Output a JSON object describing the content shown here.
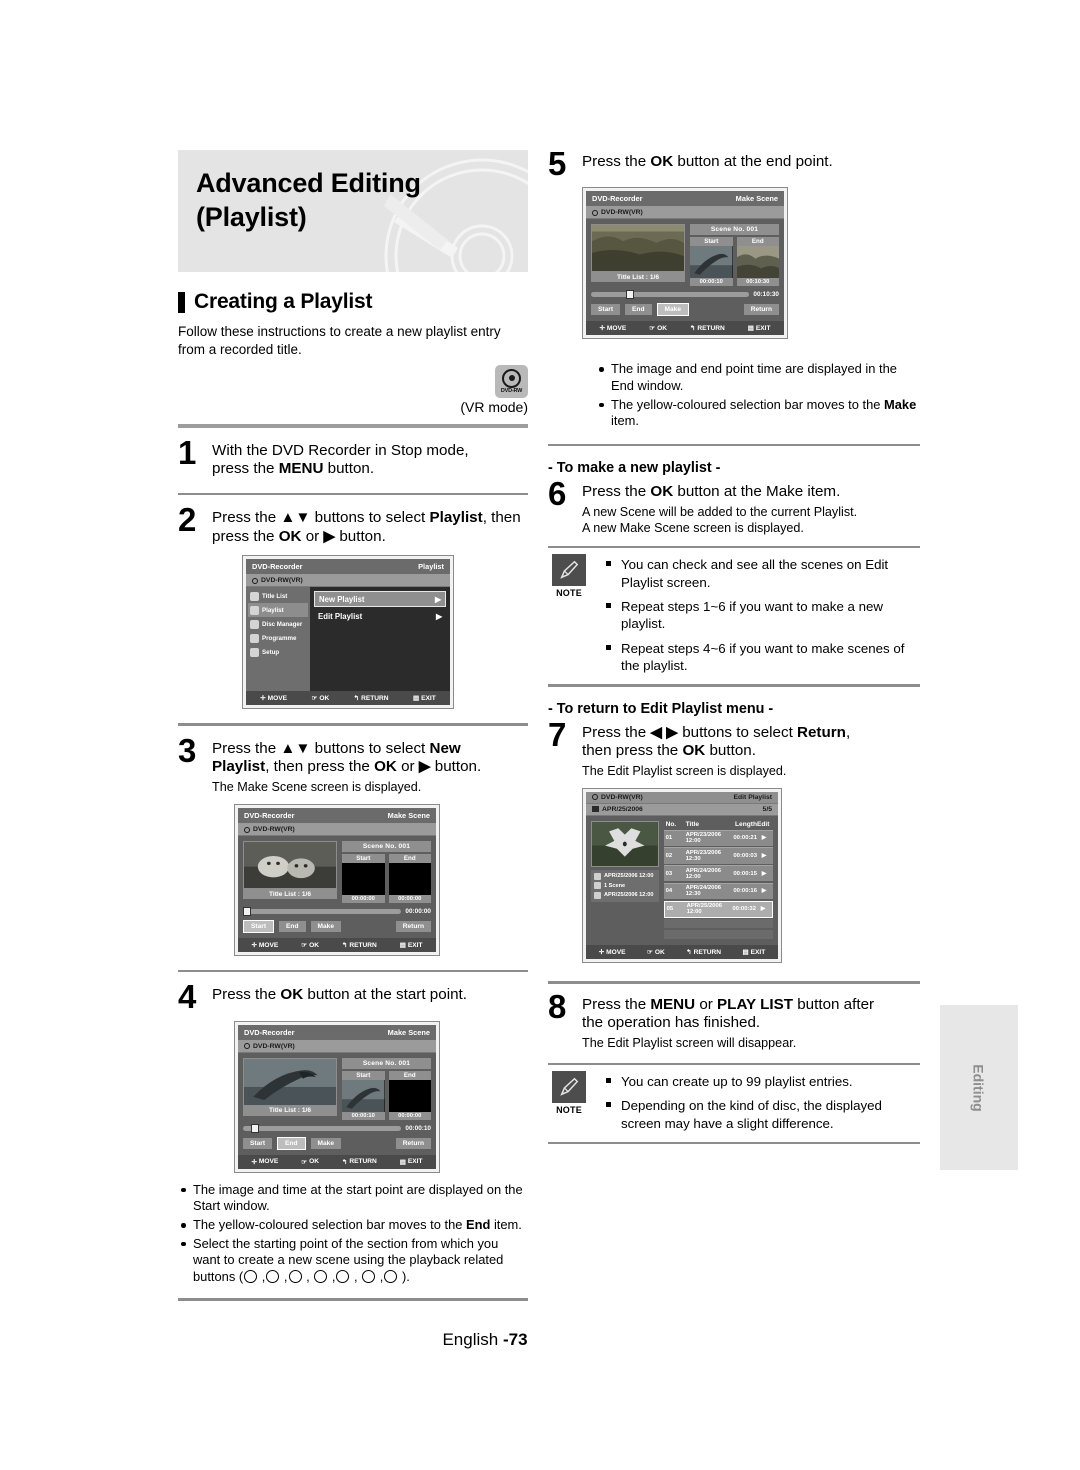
{
  "banner": {
    "title_line1": "Advanced Editing",
    "title_line2": "(Playlist)"
  },
  "section": {
    "heading": "Creating a Playlist",
    "intro": "Follow these instructions to create a new playlist entry from a recorded title.",
    "disc_badge": "DVD-RW",
    "mode": "(VR mode)"
  },
  "steps": {
    "s1": {
      "num": "1",
      "line1": "With the DVD Recorder in Stop mode,",
      "line2": "press the MENU button."
    },
    "s2": {
      "num": "2",
      "line1": "Press the ▲▼ buttons to select Playlist, then",
      "line2": "press the OK or ▶ button."
    },
    "s3": {
      "num": "3",
      "line1": "Press the ▲▼ buttons to select New",
      "line2": "Playlist, then press the OK or ▶ button.",
      "sub": "The Make Scene screen is displayed."
    },
    "s4": {
      "num": "4",
      "line1": "Press the OK button at the start point."
    },
    "s5": {
      "num": "5",
      "line1": "Press the OK button at the end point."
    },
    "s6": {
      "num": "6",
      "line1": "Press the OK button at the Make item.",
      "sub1": "A new Scene will be added to the current Playlist.",
      "sub2": "A new Make Scene screen is displayed."
    },
    "s7": {
      "num": "7",
      "line1": "Press the ◀ ▶ buttons to select Return,",
      "line2": "then press the OK button.",
      "sub": "The Edit Playlist screen is displayed."
    },
    "s8": {
      "num": "8",
      "line1": "Press the MENU or PLAY LIST button after",
      "line2": "the operation has finished.",
      "sub": "The Edit Playlist screen will disappear."
    }
  },
  "bullets_step4": [
    "The image and time at the start point are displayed on the Start window.",
    "The yellow-coloured selection bar moves to the End item.",
    "Select the starting point of the section from which you want to create a new scene using the playback related buttons"
  ],
  "bullets_step5": [
    "The image and end point time are displayed in the End window.",
    "The yellow-coloured selection bar moves to the Make item."
  ],
  "subheads": {
    "make_new": "- To make a new playlist -",
    "return_edit": "- To return to Edit Playlist menu -"
  },
  "note1": {
    "caption": "NOTE",
    "items": [
      "You can check and see all the scenes on Edit Playlist screen.",
      "Repeat steps 1~6 if you want to make a new playlist.",
      "Repeat steps 4~6 if you want to make scenes of the playlist."
    ]
  },
  "note2": {
    "caption": "NOTE",
    "items": [
      "You can create up to 99 playlist entries.",
      "Depending on the kind of disc, the displayed screen may have a slight difference."
    ]
  },
  "osd_common": {
    "recorder": "DVD-Recorder",
    "disc": "DVD-RW(VR)",
    "foot_move": "MOVE",
    "foot_ok": "OK",
    "foot_return": "RETURN",
    "foot_exit": "EXIT"
  },
  "osd_menu": {
    "title_right": "Playlist",
    "side_items": [
      {
        "label": "Title List",
        "selected": false
      },
      {
        "label": "Playlist",
        "selected": true
      },
      {
        "label": "Disc Manager",
        "selected": false
      },
      {
        "label": "Programme",
        "selected": false
      },
      {
        "label": "Setup",
        "selected": false
      }
    ],
    "rows": [
      {
        "label": "New Playlist",
        "selected": true,
        "arrow": "▶"
      },
      {
        "label": "Edit Playlist",
        "selected": false,
        "arrow": "▶"
      }
    ]
  },
  "osd_make_scene_3": {
    "title_right": "Make Scene",
    "caption": "Title List : 1/6",
    "scene_label": "Scene  No. 001",
    "start_label": "Start",
    "end_label": "End",
    "start_time": "00:00:00",
    "end_time": "00:00:00",
    "total_time": "00:00:00",
    "knob_pct": 0,
    "btn_start": "Start",
    "btn_end": "End",
    "btn_make": "Make",
    "btn_return": "Return",
    "selected_btn": "Start"
  },
  "osd_make_scene_4": {
    "title_right": "Make Scene",
    "caption": "Title List : 1/6",
    "scene_label": "Scene  No. 001",
    "start_label": "Start",
    "end_label": "End",
    "start_time": "00:00:10",
    "end_time": "00:00:00",
    "total_time": "00:00:10",
    "knob_pct": 5,
    "btn_start": "Start",
    "btn_end": "End",
    "btn_make": "Make",
    "btn_return": "Return",
    "selected_btn": "End"
  },
  "osd_make_scene_5": {
    "title_right": "Make Scene",
    "caption": "Title List : 1/6",
    "scene_label": "Scene  No. 001",
    "start_label": "Start",
    "end_label": "End",
    "start_time": "00:00:10",
    "end_time": "00:10:30",
    "total_time": "00:10:30",
    "knob_pct": 22,
    "btn_start": "Start",
    "btn_end": "End",
    "btn_make": "Make",
    "btn_return": "Return",
    "selected_btn": "Make"
  },
  "osd_edit_playlist": {
    "title_right": "Edit Playlist",
    "disc": "DVD-RW(VR)",
    "date_header": "APR/25/2006",
    "count": "5/5",
    "info": [
      "APR/25/2006 12:00",
      "1 Scene",
      "APR/25/2006 12:00"
    ],
    "columns": [
      "No.",
      "Title",
      "Length",
      "Edit"
    ],
    "rows": [
      {
        "no": "01",
        "title": "APR/23/2006  12:00",
        "length": "00:00:21",
        "edit": "▶",
        "selected": false
      },
      {
        "no": "02",
        "title": "APR/23/2006  12:30",
        "length": "00:00:03",
        "edit": "▶",
        "selected": false
      },
      {
        "no": "03",
        "title": "APR/24/2006  12:00",
        "length": "00:00:15",
        "edit": "▶",
        "selected": false
      },
      {
        "no": "04",
        "title": "APR/24/2006  12:30",
        "length": "00:00:16",
        "edit": "▶",
        "selected": false
      },
      {
        "no": "05",
        "title": "APR/25/2006  12:00",
        "length": "00:00:32",
        "edit": "▶",
        "selected": true
      }
    ]
  },
  "side_tab": {
    "label": "Editing"
  },
  "footer": {
    "lang": "English ",
    "page": "-73"
  }
}
